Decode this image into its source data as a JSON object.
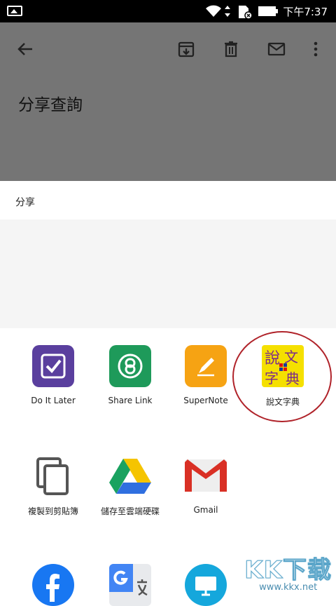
{
  "status_bar": {
    "time": "下午7:37"
  },
  "note": {
    "title": "分享查詢"
  },
  "share_sheet": {
    "header": "分享",
    "apps": [
      {
        "label": "Do It Later"
      },
      {
        "label": "Share Link"
      },
      {
        "label": "SuperNote"
      },
      {
        "label": "說文字典"
      },
      {
        "label": "複製到剪貼簿"
      },
      {
        "label": "儲存至雲端硬碟"
      },
      {
        "label": "Gmail"
      }
    ],
    "dict_icon_text": [
      "說",
      "文",
      "字",
      "典"
    ]
  },
  "watermark": {
    "brand": "KK下载",
    "url": "www.kkx.net"
  },
  "colors": {
    "app_bar": "#757575",
    "highlight_circle": "#b0232a",
    "do_it_later": "#5a3f9e",
    "share_link": "#1e9a5a",
    "supernote": "#f6a313",
    "dict_bg": "#f5e000"
  }
}
